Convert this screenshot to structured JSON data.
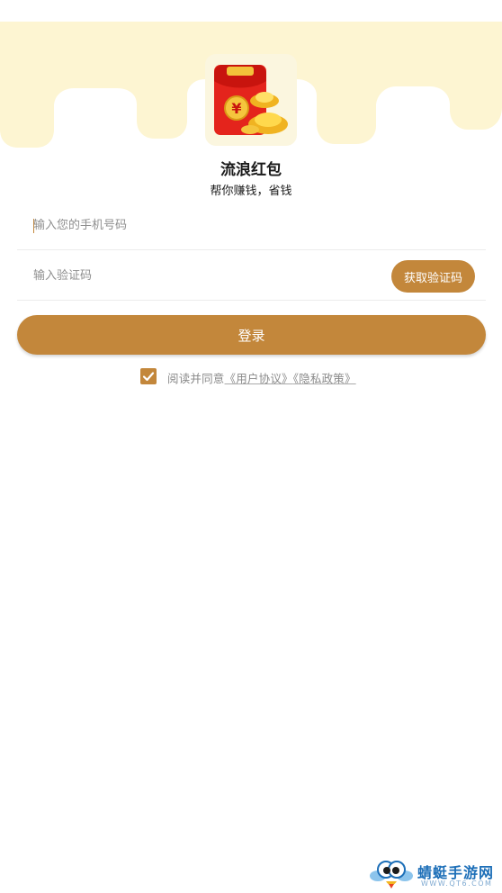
{
  "colors": {
    "accent": "#c3873b",
    "header_background": "#fdf5d2",
    "placeholder": "#8f8f8f"
  },
  "app": {
    "name": "流浪红包",
    "slogan": "帮你赚钱，省钱",
    "logo_icon": "red-envelope-gold-ingot-icon"
  },
  "form": {
    "phone_placeholder": "输入您的手机号码",
    "phone_value": "",
    "code_placeholder": "输入验证码",
    "code_value": "",
    "get_code_label": "获取验证码",
    "login_label": "登录"
  },
  "agreement": {
    "checked": true,
    "prefix": "阅读并同意",
    "user_agreement": "《用户协议》",
    "privacy_policy": "《隐私政策》"
  },
  "watermark": {
    "name": "蜻蜓手游网",
    "url": "WWW.QT6.COM",
    "icon": "dragonfly-mascot-icon"
  }
}
